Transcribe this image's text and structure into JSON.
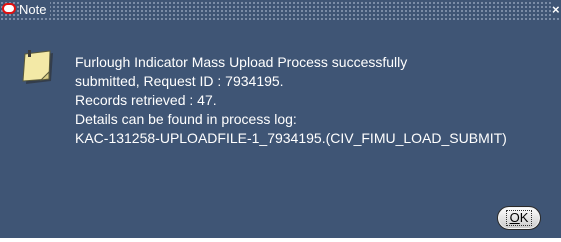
{
  "window": {
    "title": "Note",
    "close_glyph": "×"
  },
  "message": {
    "lines": [
      "Furlough Indicator Mass Upload Process successfully",
      "submitted, Request ID : 7934195.",
      "Records retrieved : 47.",
      "Details can be found in process log:",
      "KAC-131258-UPLOADFILE-1_7934195.(CIV_FIMU_LOAD_SUBMIT)"
    ]
  },
  "buttons": {
    "ok_mnemonic": "O",
    "ok_rest": "K"
  },
  "colors": {
    "background": "#3f5575",
    "text": "#ffffff",
    "title_icon": "#e01010",
    "note_paper": "#f3e9a6"
  },
  "icons": {
    "title": "oracle-ring-icon",
    "message": "note-paper-icon",
    "close": "close-icon"
  }
}
